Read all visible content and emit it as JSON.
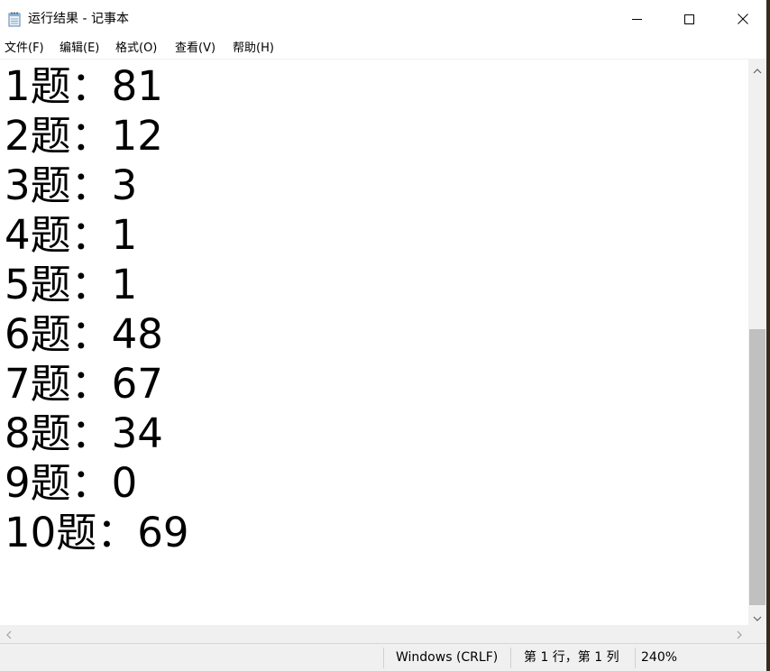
{
  "window": {
    "title": "运行结果 - 记事本"
  },
  "menu": {
    "items": [
      {
        "label": "文件(F)"
      },
      {
        "label": "编辑(E)"
      },
      {
        "label": "格式(O)"
      },
      {
        "label": "查看(V)"
      },
      {
        "label": "帮助(H)"
      }
    ]
  },
  "editor": {
    "lines": [
      {
        "text": "1题：81"
      },
      {
        "text": "2题：12"
      },
      {
        "text": "3题：3"
      },
      {
        "text": "4题：1"
      },
      {
        "text": "5题：1"
      },
      {
        "text": "6题：48"
      },
      {
        "text": "7题：67"
      },
      {
        "text": "8题：34"
      },
      {
        "text": "9题：0"
      },
      {
        "text": "10题：69"
      }
    ]
  },
  "status": {
    "line_ending": "Windows (CRLF)",
    "position": "第 1 行，第 1 列",
    "zoom": "240%"
  },
  "icons": {
    "app": "notepad-icon",
    "minimize": "minimize-icon",
    "maximize": "maximize-icon",
    "close": "close-icon"
  }
}
